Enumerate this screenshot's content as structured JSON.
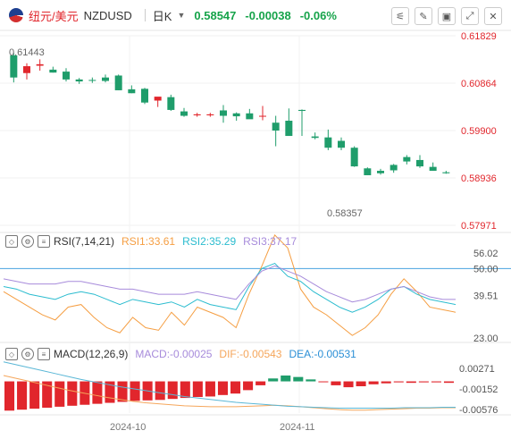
{
  "header": {
    "pair_cn": "纽元/美元",
    "symbol": "NZDUSD",
    "period": "日K",
    "price": "0.58547",
    "change": "-0.00038",
    "change_pct": "-0.06%"
  },
  "rsi_legend": {
    "label": "RSI(7,14,21)",
    "rsi1": "RSI1:33.61",
    "rsi2": "RSI2:35.29",
    "rsi3": "RSI3:37.17"
  },
  "macd_legend": {
    "label": "MACD(12,26,9)",
    "macd": "MACD:-0.00025",
    "dif": "DIF:-0.00543",
    "dea": "DEA:-0.00531"
  },
  "colors": {
    "up": "#e1262c",
    "down": "#1f9d6b",
    "rsi1": "#f59e42",
    "rsi2": "#2bbccf",
    "rsi3": "#a78bdb",
    "dif": "#f5a65b",
    "dea": "#5ab7d6",
    "ref": "#4aa3df"
  },
  "chart_data": [
    {
      "type": "candlestick",
      "price_axis_labels": [
        "0.61829",
        "0.60864",
        "0.59900",
        "0.58936",
        "0.57971"
      ],
      "x_tick_labels": [
        "2024-10",
        "2024-11"
      ],
      "annotations": {
        "high": "0.61443",
        "low": "0.58357"
      },
      "ylim": [
        0.5797,
        0.6183
      ],
      "candles": [
        {
          "o": 0.6143,
          "h": 0.6148,
          "l": 0.6088,
          "c": 0.6098
        },
        {
          "o": 0.6107,
          "h": 0.6127,
          "l": 0.6094,
          "c": 0.6121
        },
        {
          "o": 0.6122,
          "h": 0.6135,
          "l": 0.6112,
          "c": 0.6125
        },
        {
          "o": 0.6114,
          "h": 0.612,
          "l": 0.6108,
          "c": 0.6108
        },
        {
          "o": 0.611,
          "h": 0.6117,
          "l": 0.609,
          "c": 0.6094
        },
        {
          "o": 0.6094,
          "h": 0.6097,
          "l": 0.6085,
          "c": 0.609
        },
        {
          "o": 0.6093,
          "h": 0.6098,
          "l": 0.6087,
          "c": 0.6092
        },
        {
          "o": 0.6098,
          "h": 0.6104,
          "l": 0.6088,
          "c": 0.6091
        },
        {
          "o": 0.6102,
          "h": 0.6104,
          "l": 0.6072,
          "c": 0.6072
        },
        {
          "o": 0.6074,
          "h": 0.6082,
          "l": 0.6066,
          "c": 0.6066
        },
        {
          "o": 0.6075,
          "h": 0.6077,
          "l": 0.6044,
          "c": 0.6047
        },
        {
          "o": 0.6051,
          "h": 0.6055,
          "l": 0.6038,
          "c": 0.6059
        },
        {
          "o": 0.6058,
          "h": 0.6063,
          "l": 0.603,
          "c": 0.6032
        },
        {
          "o": 0.6029,
          "h": 0.6036,
          "l": 0.6018,
          "c": 0.602
        },
        {
          "o": 0.6021,
          "h": 0.6026,
          "l": 0.6018,
          "c": 0.6023
        },
        {
          "o": 0.6021,
          "h": 0.6026,
          "l": 0.6018,
          "c": 0.6023
        },
        {
          "o": 0.6031,
          "h": 0.6042,
          "l": 0.6006,
          "c": 0.602
        },
        {
          "o": 0.6025,
          "h": 0.6027,
          "l": 0.601,
          "c": 0.6019
        },
        {
          "o": 0.6025,
          "h": 0.6034,
          "l": 0.6016,
          "c": 0.6013
        },
        {
          "o": 0.6019,
          "h": 0.604,
          "l": 0.6011,
          "c": 0.602
        },
        {
          "o": 0.6006,
          "h": 0.602,
          "l": 0.5958,
          "c": 0.599
        },
        {
          "o": 0.601,
          "h": 0.6035,
          "l": 0.598,
          "c": 0.5979
        },
        {
          "o": 0.6032,
          "h": 0.6033,
          "l": 0.5979,
          "c": 0.603
        },
        {
          "o": 0.5978,
          "h": 0.5986,
          "l": 0.5972,
          "c": 0.5975
        },
        {
          "o": 0.5976,
          "h": 0.5992,
          "l": 0.595,
          "c": 0.5955
        },
        {
          "o": 0.5969,
          "h": 0.5976,
          "l": 0.595,
          "c": 0.5955
        },
        {
          "o": 0.5955,
          "h": 0.5958,
          "l": 0.5916,
          "c": 0.5917
        },
        {
          "o": 0.5913,
          "h": 0.5915,
          "l": 0.5899,
          "c": 0.5899
        },
        {
          "o": 0.5908,
          "h": 0.5912,
          "l": 0.59,
          "c": 0.5903
        },
        {
          "o": 0.592,
          "h": 0.5922,
          "l": 0.5904,
          "c": 0.5909
        },
        {
          "o": 0.5936,
          "h": 0.594,
          "l": 0.5921,
          "c": 0.5927
        },
        {
          "o": 0.593,
          "h": 0.594,
          "l": 0.5914,
          "c": 0.5917
        },
        {
          "o": 0.5916,
          "h": 0.5925,
          "l": 0.5908,
          "c": 0.5908
        },
        {
          "o": 0.5905,
          "h": 0.5908,
          "l": 0.5902,
          "c": 0.5903
        }
      ]
    },
    {
      "type": "line",
      "title": "RSI(7,14,21)",
      "y_labels": [
        "56.02",
        "50.00",
        "39.51",
        "23.00"
      ],
      "ylim": [
        23.0,
        56.02
      ],
      "reference_line": 50.0,
      "series": [
        {
          "name": "RSI1",
          "values": [
            41,
            38,
            35,
            32,
            30,
            35,
            36,
            31,
            27,
            25,
            31,
            27,
            26,
            33,
            28,
            35,
            33,
            31,
            27,
            40,
            51,
            63,
            58,
            42,
            35,
            32,
            28,
            24,
            27,
            32,
            40,
            46,
            41,
            35,
            34,
            33
          ]
        },
        {
          "name": "RSI2",
          "values": [
            43,
            42,
            40,
            39,
            38,
            40,
            41,
            40,
            38,
            36,
            38,
            37,
            36,
            37,
            35,
            38,
            36,
            35,
            34,
            43,
            50,
            52,
            47,
            45,
            41,
            38,
            35,
            33,
            35,
            38,
            42,
            43,
            40,
            38,
            37,
            36
          ]
        },
        {
          "name": "RSI3",
          "values": [
            46,
            45,
            44,
            44,
            44,
            45,
            45,
            44,
            43,
            42,
            42,
            41,
            40,
            40,
            40,
            41,
            40,
            39,
            38,
            44,
            49,
            51,
            49,
            47,
            44,
            41,
            39,
            37,
            38,
            40,
            42,
            43,
            41,
            39,
            38,
            38
          ]
        }
      ]
    },
    {
      "type": "bar",
      "title": "MACD(12,26,9)",
      "y_labels": [
        "0.00271",
        "-0.00152",
        "-0.00576"
      ],
      "ylim": [
        -0.0065,
        0.0034
      ],
      "series": [
        {
          "name": "MACD",
          "values": [
            -0.006,
            -0.0058,
            -0.0056,
            -0.0054,
            -0.0052,
            -0.005,
            -0.0048,
            -0.0046,
            -0.0044,
            -0.0042,
            -0.004,
            -0.0039,
            -0.0038,
            -0.0036,
            -0.0034,
            -0.0032,
            -0.0031,
            -0.0028,
            -0.0025,
            -0.0018,
            -0.0008,
            0.0006,
            0.0012,
            0.0009,
            0.0004,
            -0.0001,
            -0.0008,
            -0.0012,
            -0.001,
            -0.0006,
            -0.0004,
            -0.0002,
            -0.0003,
            -0.0002,
            -0.0002,
            -0.0003
          ]
        },
        {
          "name": "DIF",
          "values": [
            0.0012,
            0.0006,
            0.0,
            -0.0006,
            -0.0012,
            -0.0018,
            -0.0023,
            -0.0028,
            -0.0033,
            -0.0037,
            -0.0041,
            -0.0044,
            -0.0046,
            -0.0048,
            -0.005,
            -0.0051,
            -0.0052,
            -0.0052,
            -0.0052,
            -0.0051,
            -0.005,
            -0.0049,
            -0.005,
            -0.0052,
            -0.0054,
            -0.0056,
            -0.0058,
            -0.0059,
            -0.0059,
            -0.0058,
            -0.0057,
            -0.0056,
            -0.0055,
            -0.0055,
            -0.0054,
            -0.0054
          ]
        },
        {
          "name": "DEA",
          "values": [
            0.004,
            0.0034,
            0.0028,
            0.0022,
            0.0016,
            0.001,
            0.0004,
            -0.0001,
            -0.0006,
            -0.0011,
            -0.0015,
            -0.0019,
            -0.0023,
            -0.0027,
            -0.0031,
            -0.0034,
            -0.0037,
            -0.004,
            -0.0043,
            -0.0045,
            -0.0047,
            -0.0049,
            -0.0051,
            -0.0052,
            -0.0053,
            -0.0054,
            -0.0055,
            -0.0055,
            -0.0055,
            -0.0055,
            -0.0055,
            -0.0054,
            -0.0054,
            -0.0054,
            -0.0053,
            -0.0053
          ]
        }
      ]
    }
  ]
}
